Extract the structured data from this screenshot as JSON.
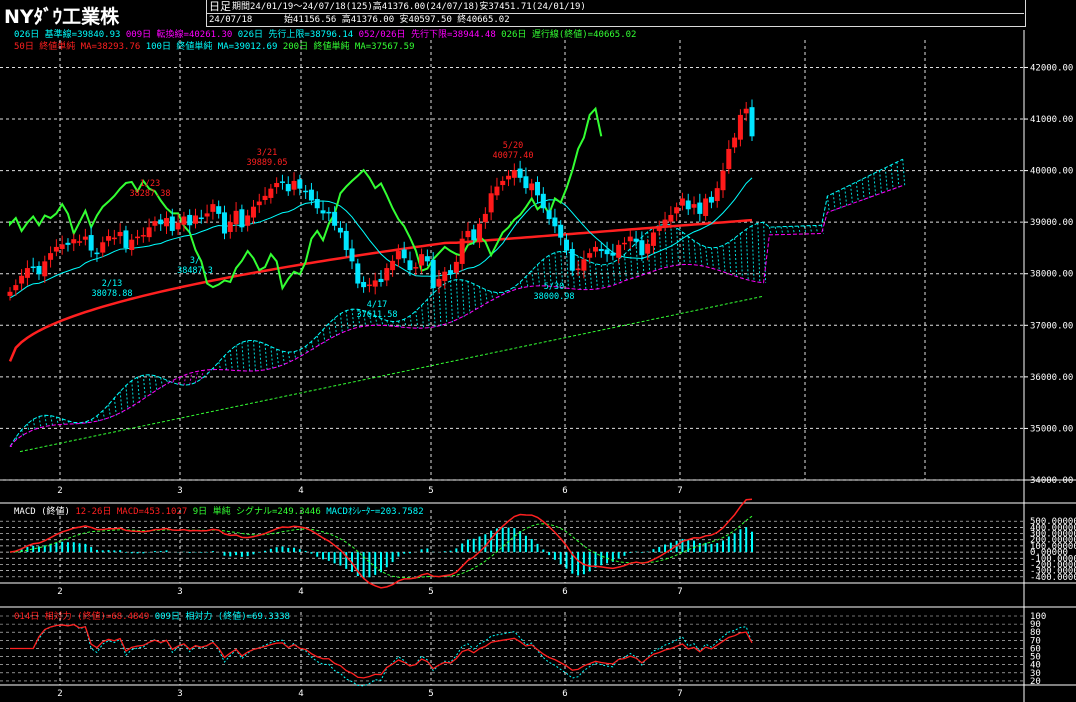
{
  "header": {
    "title": "NYﾀﾞｳ工業株",
    "period_type": "日足",
    "period_info": "期間24/01/19～24/07/18(125)高41376.00(24/07/18)安37451.71(24/01/19)",
    "date": "24/07/18",
    "ohlc": "始41156.56 高41376.00 安40597.50 終40665.02"
  },
  "ichimoku_legend": [
    {
      "text": "026日 基準線=39840.93",
      "color": "#00ffff"
    },
    {
      "text": "009日 転換線=40261.30",
      "color": "#ff00ff"
    },
    {
      "text": "026日 先行上限=38796.14",
      "color": "#00ffff"
    },
    {
      "text": "052/026日 先行下限=38944.48",
      "color": "#ff00ff"
    },
    {
      "text": "026日 遅行線(終値)=40665.02",
      "color": "#33ff33"
    }
  ],
  "ma_legend": [
    {
      "text": "50日 終値単純 MA=38293.76",
      "color": "#ff2020"
    },
    {
      "text": "100日 終値単純 MA=39012.69",
      "color": "#00ffff"
    },
    {
      "text": "200日 終値単純 MA=37567.59",
      "color": "#33ff33"
    }
  ],
  "macd_legend": [
    {
      "text": "MACD (終値)",
      "color": "#ffffff"
    },
    {
      "text": "12-26日 MACD=453.1027",
      "color": "#ff2020"
    },
    {
      "text": "9日 単純 シグナル=249.3446",
      "color": "#33ff33"
    },
    {
      "text": "MACDｵｼﾚｰﾀｰ=203.7582",
      "color": "#00ffff"
    }
  ],
  "rsi_legend": [
    {
      "text": "014日 相対力 (終値)=68.4849",
      "color": "#ff2020"
    },
    {
      "text": "009日 相対力 (終値)=69.3338",
      "color": "#00ffff"
    }
  ],
  "colors": {
    "up": "#ff1a1a",
    "down": "#00e5ff",
    "grid": "#e0e0e0",
    "cloud_up": "#00ffff",
    "cloud_down": "#ff00ff"
  },
  "chart_data": {
    "type": "candlestick",
    "ylim": [
      34000,
      42300
    ],
    "price_ticks": [
      "42000.00",
      "41000.00",
      "40000.00",
      "39000.00",
      "38000.00",
      "37000.00",
      "36000.00",
      "35000.00",
      "34000.00"
    ],
    "month_labels": [
      "2",
      "3",
      "4",
      "5",
      "6",
      "7"
    ],
    "annotations": [
      {
        "date": "1/23",
        "value": "38287.38",
        "color": "#ff2020"
      },
      {
        "date": "2/13",
        "value": "38078.88",
        "color": "#00ffff"
      },
      {
        "date": "3/",
        "value": "38487.3",
        "color": "#00ffff"
      },
      {
        "date": "3/21",
        "value": "39889.05",
        "color": "#ff2020"
      },
      {
        "date": "4/17",
        "value": "37611.58",
        "color": "#00ffff"
      },
      {
        "date": "5/20",
        "value": "40077.40",
        "color": "#ff2020"
      },
      {
        "date": "5/30",
        "value": "38000.98",
        "color": "#00ffff"
      }
    ],
    "closes": [
      37650,
      37780,
      37960,
      38110,
      38120,
      37990,
      38240,
      38400,
      38520,
      38570,
      38560,
      38670,
      38630,
      38720,
      38450,
      38380,
      38610,
      38730,
      38700,
      38810,
      38500,
      38660,
      38720,
      38750,
      38900,
      39020,
      38960,
      39080,
      38830,
      38990,
      39110,
      38940,
      39130,
      39080,
      39170,
      39350,
      39160,
      38780,
      39000,
      39220,
      38900,
      39130,
      39300,
      39400,
      39510,
      39650,
      39760,
      39780,
      39600,
      39800,
      39650,
      39600,
      39420,
      39270,
      39170,
      39170,
      38930,
      38800,
      38460,
      38240,
      37810,
      37740,
      37790,
      37870,
      37840,
      38110,
      38250,
      38440,
      38300,
      38070,
      38130,
      38380,
      38240,
      37720,
      37900,
      38040,
      37990,
      38230,
      38680,
      38830,
      38650,
      38970,
      39160,
      39560,
      39690,
      39800,
      39900,
      40010,
      39860,
      39660,
      39750,
      39520,
      39270,
      39060,
      38920,
      38700,
      38450,
      38060,
      38100,
      38280,
      38400,
      38520,
      38440,
      38380,
      38350,
      38560,
      38600,
      38720,
      38620,
      38360,
      38580,
      38800,
      38900,
      39050,
      39140,
      39290,
      39460,
      39250,
      39350,
      39160,
      39460,
      39380,
      39660,
      40000,
      40420,
      40640,
      41080,
      41200,
      40665
    ]
  },
  "macd_data": {
    "ylim": [
      -500,
      600
    ],
    "ticks": [
      "500.00000",
      "400.00000",
      "300.00000",
      "200.00000",
      "100.00000",
      "0.00000",
      "-100.00000",
      "-200.00000",
      "-300.00000",
      "-400.00000"
    ]
  },
  "rsi_data": {
    "ylim": [
      15,
      100
    ],
    "ticks": [
      "100",
      "90",
      "80",
      "70",
      "60",
      "50",
      "40",
      "30",
      "20"
    ]
  }
}
